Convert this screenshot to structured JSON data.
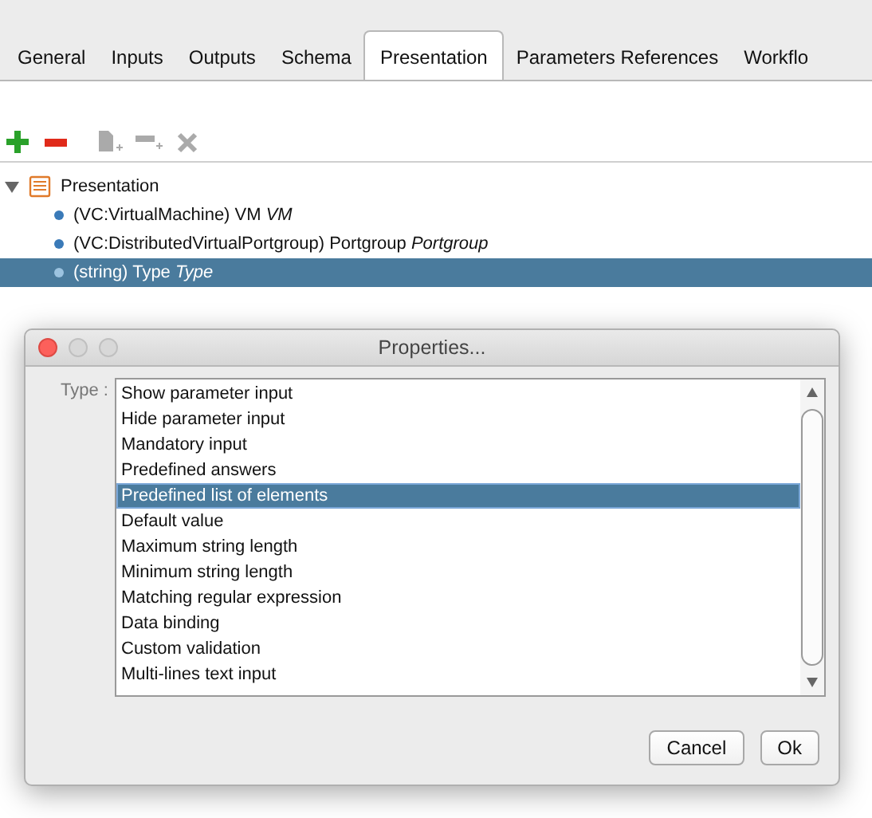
{
  "tabs": [
    {
      "label": "General",
      "selected": false
    },
    {
      "label": "Inputs",
      "selected": false
    },
    {
      "label": "Outputs",
      "selected": false
    },
    {
      "label": "Schema",
      "selected": false
    },
    {
      "label": "Presentation",
      "selected": true
    },
    {
      "label": "Parameters References",
      "selected": false
    },
    {
      "label": "Workflo",
      "selected": false
    }
  ],
  "toolbar": [
    {
      "kind": "add",
      "disabled": false
    },
    {
      "kind": "remove",
      "disabled": false
    },
    {
      "kind": "new-page",
      "disabled": true
    },
    {
      "kind": "new-step",
      "disabled": true
    },
    {
      "kind": "delete",
      "disabled": true
    }
  ],
  "tree": {
    "label": "Presentation",
    "expanded": true,
    "children": [
      {
        "label": "(VC:VirtualMachine) VM *VM*",
        "selected": false
      },
      {
        "label": "(VC:DistributedVirtualPortgroup) Portgroup *Portgroup*",
        "selected": false
      },
      {
        "label": "(string) Type *Type*",
        "selected": true
      }
    ]
  },
  "dialog": {
    "title": "Properties...",
    "field_label": "Type :",
    "options": [
      {
        "label": "Show parameter input",
        "selected": false
      },
      {
        "label": "Hide parameter input",
        "selected": false
      },
      {
        "label": "Mandatory input",
        "selected": false
      },
      {
        "label": "Predefined answers",
        "selected": false
      },
      {
        "label": "Predefined list of elements",
        "selected": true
      },
      {
        "label": "Default value",
        "selected": false
      },
      {
        "label": "Maximum string length",
        "selected": false
      },
      {
        "label": "Minimum string length",
        "selected": false
      },
      {
        "label": "Matching regular expression",
        "selected": false
      },
      {
        "label": "Data binding",
        "selected": false
      },
      {
        "label": "Custom validation",
        "selected": false
      },
      {
        "label": "Multi-lines text input",
        "selected": false
      }
    ],
    "buttons": [
      "Cancel",
      "Ok"
    ]
  }
}
